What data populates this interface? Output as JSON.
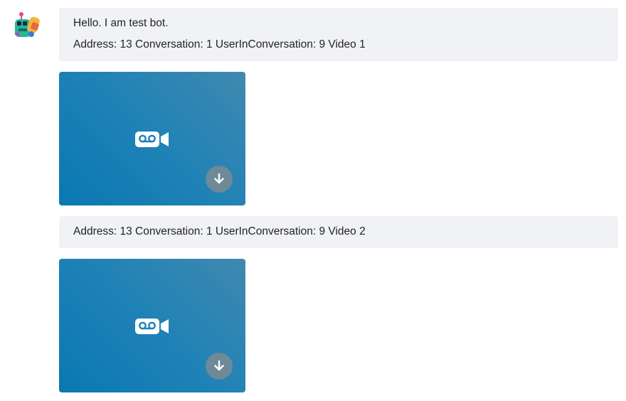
{
  "messages": [
    {
      "lines": [
        "Hello. I am test bot.",
        "Address: 13 Conversation: 1 UserInConversation: 9 Video 1"
      ]
    },
    {
      "lines": [
        "Address: 13 Conversation: 1 UserInConversation: 9 Video 2"
      ]
    }
  ],
  "attachments": [
    {
      "type": "video",
      "icon": "video-recording-icon",
      "action_icon": "download-icon"
    },
    {
      "type": "video",
      "icon": "video-recording-icon",
      "action_icon": "download-icon"
    }
  ],
  "colors": {
    "bubble_bg": "#f0f2f6",
    "video_card_bg": "#1f82b6",
    "download_button_bg": "#8c8c8c",
    "text": "#252423"
  }
}
